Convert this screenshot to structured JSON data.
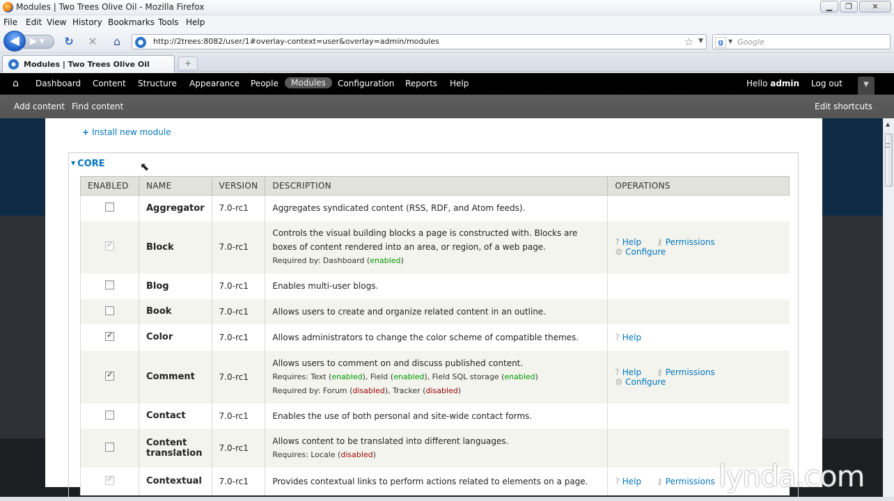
{
  "window": {
    "title": "Modules | Two Trees Olive Oil - Mozilla Firefox",
    "controls": [
      "▁",
      "❐",
      "✕"
    ]
  },
  "menubar": [
    "File",
    "Edit",
    "View",
    "History",
    "Bookmarks",
    "Tools",
    "Help"
  ],
  "nav": {
    "url": "http://2trees:8082/user/1#overlay-context=user&overlay=admin/modules",
    "search_placeholder": "Google"
  },
  "tab": {
    "label": "Modules | Two Trees Olive Oil",
    "new_tab": "+"
  },
  "toolbar": {
    "items": [
      "Dashboard",
      "Content",
      "Structure",
      "Appearance",
      "People",
      "Modules",
      "Configuration",
      "Reports",
      "Help"
    ],
    "active": "Modules",
    "hello_prefix": "Hello ",
    "user": "admin",
    "logout": "Log out"
  },
  "shortcuts": {
    "add": "Add content",
    "find": "Find content",
    "edit": "Edit shortcuts"
  },
  "page": {
    "install_link": "Install new module",
    "fieldset_legend": "CORE"
  },
  "table": {
    "headers": [
      "ENABLED",
      "NAME",
      "VERSION",
      "DESCRIPTION",
      "OPERATIONS"
    ],
    "rows": [
      {
        "enabled": false,
        "disabled_cb": false,
        "name": "Aggregator",
        "version": "7.0-rc1",
        "description": "Aggregates syndicated content (RSS, RDF, and Atom feeds).",
        "ops": []
      },
      {
        "enabled": true,
        "disabled_cb": true,
        "name": "Block",
        "version": "7.0-rc1",
        "description": "Controls the visual building blocks a page is constructed with. Blocks are boxes of content rendered into an area, or region, of a web page.",
        "required_by": "Required by: Dashboard (enabled)",
        "ops": [
          "Help",
          "Permissions",
          "Configure"
        ]
      },
      {
        "enabled": false,
        "disabled_cb": false,
        "name": "Blog",
        "version": "7.0-rc1",
        "description": "Enables multi-user blogs.",
        "ops": []
      },
      {
        "enabled": false,
        "disabled_cb": false,
        "name": "Book",
        "version": "7.0-rc1",
        "description": "Allows users to create and organize related content in an outline.",
        "ops": []
      },
      {
        "enabled": true,
        "disabled_cb": false,
        "name": "Color",
        "version": "7.0-rc1",
        "description": "Allows administrators to change the color scheme of compatible themes.",
        "ops": [
          "Help"
        ]
      },
      {
        "enabled": true,
        "disabled_cb": false,
        "name": "Comment",
        "version": "7.0-rc1",
        "description": "Allows users to comment on and discuss published content.",
        "requires": "Requires: Text (enabled), Field (enabled), Field SQL storage (enabled)",
        "required_by": "Required by: Forum (disabled), Tracker (disabled)",
        "ops": [
          "Help",
          "Permissions",
          "Configure"
        ]
      },
      {
        "enabled": false,
        "disabled_cb": false,
        "name": "Contact",
        "version": "7.0-rc1",
        "description": "Enables the use of both personal and site-wide contact forms.",
        "ops": []
      },
      {
        "enabled": false,
        "disabled_cb": false,
        "name": "Content translation",
        "version": "7.0-rc1",
        "description": "Allows content to be translated into different languages.",
        "requires": "Requires: Locale (disabled)",
        "ops": []
      },
      {
        "enabled": true,
        "disabled_cb": true,
        "name": "Contextual",
        "version": "7.0-rc1",
        "description": "Provides contextual links to perform actions related to elements on a page.",
        "ops": [
          "Help",
          "Permissions"
        ]
      }
    ]
  },
  "watermark": "lynda.com"
}
